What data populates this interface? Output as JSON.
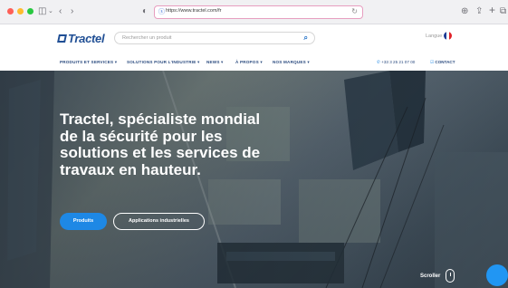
{
  "browser": {
    "url": "https://www.tractel.com/fr",
    "icons": [
      "sidebar-icon",
      "back-icon",
      "forward-icon",
      "shield-icon",
      "reload-icon",
      "download-icon",
      "share-icon",
      "new-tab-icon",
      "tabs-icon"
    ]
  },
  "header": {
    "logo": "Tractel",
    "search_placeholder": "Rechercher un produit",
    "language_label": "Langue :",
    "language_flag": "fr-flag"
  },
  "nav": {
    "items": [
      {
        "label": "PRODUITS ET SERVICES ▾"
      },
      {
        "label": "SOLUTIONS POUR L'INDUSTRIE ▾"
      },
      {
        "label": "NEWS ▾"
      },
      {
        "label": "À PROPOS ▾"
      },
      {
        "label": "NOS MARQUES ▾"
      }
    ],
    "phone": "+33 3 25 21 07 00",
    "contact": "CONTACT"
  },
  "hero": {
    "title": "Tractel, spécialiste mondial de la sécurité pour les solutions et les services de travaux en hauteur.",
    "button_primary": "Produits",
    "button_secondary": "Applications industrielles",
    "scroll_label": "Scroller"
  },
  "colors": {
    "brand_blue": "#1f4e94",
    "button_blue": "#1e88e5",
    "url_border": "#e79ec0"
  }
}
